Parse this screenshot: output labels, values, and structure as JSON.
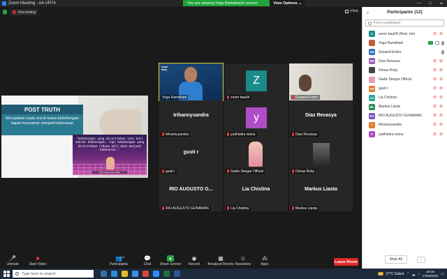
{
  "window": {
    "title": "Zoom Meeting - A4-VR74",
    "minimize": "—",
    "maximize": "□",
    "close": "✕"
  },
  "share_banner": {
    "message": "You are viewing Yoga Ramdhani's screen",
    "options": "View Options ⌄"
  },
  "recording": {
    "label": "Recording"
  },
  "view_label": "View",
  "slide": {
    "title": "POST TRUTH",
    "description": "Merupakan suatu era di mana kebohongan dapat menyamar menjadi kebenaran",
    "quote": "\"kebohongan yang diceritakan satu kali adalah kebohongan, tapi kebohongan yang diceritakan ribuan kali akan menjadi kebenaran.\"",
    "caption": "Paul Joseph Goebbels"
  },
  "tiles": [
    {
      "name": "Yoga Ramdhani",
      "type": "video1",
      "logo": "zoom fasty"
    },
    {
      "name": "zoom baa04",
      "type": "avatar",
      "letter": "Z",
      "color": "#1a8a8a"
    },
    {
      "name": "Gunardi Endro",
      "type": "video2"
    },
    {
      "name": "trihannysandra",
      "type": "text"
    },
    {
      "name": "yudhistira wisnu",
      "type": "avatar",
      "letter": "y",
      "color": "#b04cc6"
    },
    {
      "name": "Diaz Revasya",
      "type": "text"
    },
    {
      "name": "gusti r",
      "type": "text"
    },
    {
      "name": "Gadis Siregar Official",
      "type": "portrait"
    },
    {
      "name": "Dimas Roby",
      "type": "photo"
    },
    {
      "name": "RIO AUGUSTO GUNAWAN",
      "type": "text",
      "display": "RIO AUGUSTO G..."
    },
    {
      "name": "Lia Chistina",
      "type": "text"
    },
    {
      "name": "Markus Liasta",
      "type": "text"
    }
  ],
  "toolbar": {
    "unmute": "Unmute",
    "start_video": "Start Video",
    "participants": "Participants",
    "participants_count": "12",
    "chat": "Chat",
    "share_screen": "Share Screen",
    "record": "Record",
    "breakout": "Breakout Rooms",
    "reactions": "Reactions",
    "apps": "Apps",
    "leave": "Leave Room"
  },
  "panel": {
    "title": "Participants (12)",
    "search_placeholder": "Find a participant",
    "participants": [
      {
        "name": "zoom baa04 (Host, me)",
        "initials": "Z",
        "color": "#1a8a8a",
        "mic": "off",
        "cam": "off"
      },
      {
        "name": "Yoga Ramdhani",
        "initials": "",
        "color": "#c25b3a",
        "mic": "on",
        "cam": "on",
        "photo": true
      },
      {
        "name": "Gunardi Endro",
        "initials": "GE",
        "color": "#2f6fb5",
        "mic": "on",
        "cam": "on_gray"
      },
      {
        "name": "Diaz Revasya",
        "initials": "DR",
        "color": "#9b59b6",
        "mic": "off",
        "cam": "off"
      },
      {
        "name": "Dimas Roby",
        "initials": "",
        "color": "#444444",
        "mic": "off",
        "cam": "off",
        "photo": true
      },
      {
        "name": "Gadis Siregar Official",
        "initials": "",
        "color": "#e8a0b0",
        "mic": "off",
        "cam": "off",
        "photo": true
      },
      {
        "name": "gusti r",
        "initials": "GR",
        "color": "#e07a2a",
        "mic": "off",
        "cam": "off"
      },
      {
        "name": "Lia Chistina",
        "initials": "LC",
        "color": "#26a59a",
        "mic": "off",
        "cam": "off"
      },
      {
        "name": "Markus Liasta",
        "initials": "ML",
        "color": "#2e8b57",
        "mic": "off",
        "cam": "off"
      },
      {
        "name": "RIO AUGUSTO GUNAWAN",
        "initials": "RA",
        "color": "#7a52c7",
        "mic": "off",
        "cam": "off"
      },
      {
        "name": "trihannysandra",
        "initials": "T",
        "color": "#e07a2a",
        "mic": "off",
        "cam": "off"
      },
      {
        "name": "yudhistira wisnu",
        "initials": "Y",
        "color": "#b04cc6",
        "mic": "off",
        "cam": "off"
      }
    ],
    "mute_all": "Mute All",
    "more": "..."
  },
  "taskbar": {
    "search_placeholder": "Type here to search",
    "weather": "27°C Kabut",
    "time": "19:18",
    "date": "17/03/2022"
  }
}
